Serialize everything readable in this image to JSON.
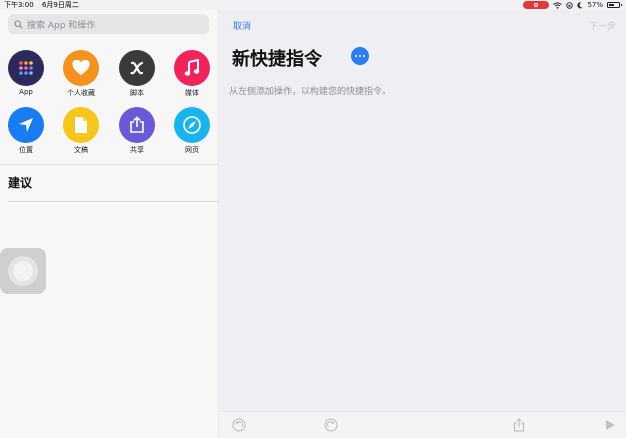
{
  "status_bar": {
    "time": "下午3:00",
    "date": "6月9日周二",
    "battery_percent": "57%",
    "battery_level": 0.57,
    "recording_color": "#e53935"
  },
  "left_panel": {
    "search_placeholder": "搜索 App 和操作",
    "categories": [
      {
        "label": "App",
        "icon": "app-grid-icon",
        "color": "#2c2a5c"
      },
      {
        "label": "个人收藏",
        "icon": "heart-icon",
        "color": "#f5911e"
      },
      {
        "label": "脚本",
        "icon": "script-x-icon",
        "color": "#3a3a3c"
      },
      {
        "label": "媒体",
        "icon": "music-note-icon",
        "color": "#f0245a"
      },
      {
        "label": "位置",
        "icon": "location-arrow-icon",
        "color": "#1a7cf2"
      },
      {
        "label": "文稿",
        "icon": "document-icon",
        "color": "#f7c51c"
      },
      {
        "label": "共享",
        "icon": "share-icon",
        "color": "#6a5ad8"
      },
      {
        "label": "网页",
        "icon": "compass-icon",
        "color": "#19b4ea"
      }
    ],
    "suggestions_title": "建议"
  },
  "editor": {
    "cancel_label": "取消",
    "next_label": "下一步",
    "title": "新快捷指令",
    "hint": "从左侧添加操作，以构建您的快捷指令。",
    "accent_color": "#2f7cf6"
  },
  "toolbar": {
    "undo_icon": "undo-icon",
    "redo_icon": "redo-icon",
    "share_icon": "share-icon",
    "play_icon": "play-icon"
  }
}
